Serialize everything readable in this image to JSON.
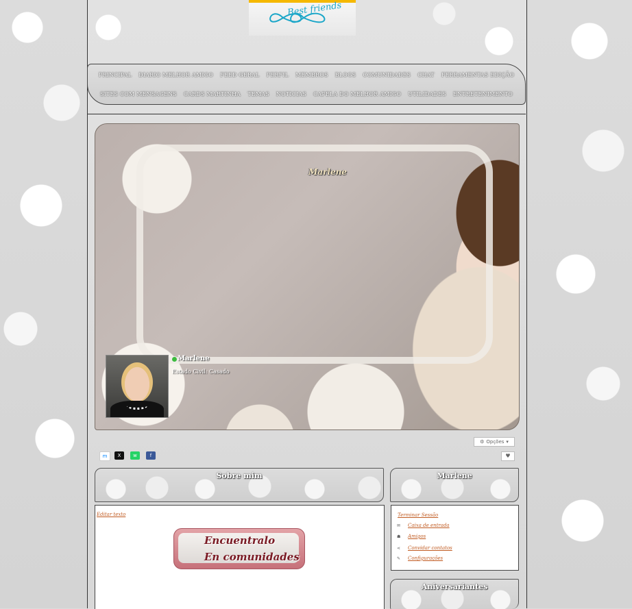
{
  "nav": {
    "row1": [
      "PRINCIPAL",
      "DIARIO MELHOR AMIGO",
      "FEED GERAL",
      "PERFIL",
      "MEMBROS",
      "BLOGS",
      "COMUNIDADES",
      "CHAT",
      "FERRAMENTAS EDIÇÃO"
    ],
    "row2": [
      "SITES COM MENSAGENS",
      "CARDS MARTINHA",
      "TEMAS",
      "NOTICIAS",
      "CAPELA DO MELHOR AMIGO",
      "UTILIDADES",
      "ENTRETENIMENTO"
    ]
  },
  "logo": {
    "text": "Best friends"
  },
  "cover": {
    "title": "Marlene"
  },
  "profile": {
    "name": "Marlene",
    "civil_status": "Estado Civil: Casado"
  },
  "actions": {
    "options_label": "Opções"
  },
  "share": {
    "messenger": "m",
    "x": "X",
    "whatsapp": "w",
    "facebook": "f"
  },
  "about": {
    "title": "Sobre mim",
    "edit_link": "Editar texto",
    "banner_line1": "Encuentralo",
    "banner_line2": "En comunidades"
  },
  "sidebar": {
    "title": "Marlene",
    "logout": "Terminar Sessão",
    "items": [
      {
        "icon": "envelope-icon",
        "label": "Caixa de entrada"
      },
      {
        "icon": "friends-icon",
        "label": "Amigos"
      },
      {
        "icon": "share-icon",
        "label": "Convidar contatos"
      },
      {
        "icon": "pencil-icon",
        "label": "Configurações"
      }
    ]
  },
  "birthdays": {
    "title": "Aniversariantes"
  },
  "colors": {
    "link": "#c05a20",
    "nav_text": "#ffffff",
    "frame_border": "#333333"
  }
}
